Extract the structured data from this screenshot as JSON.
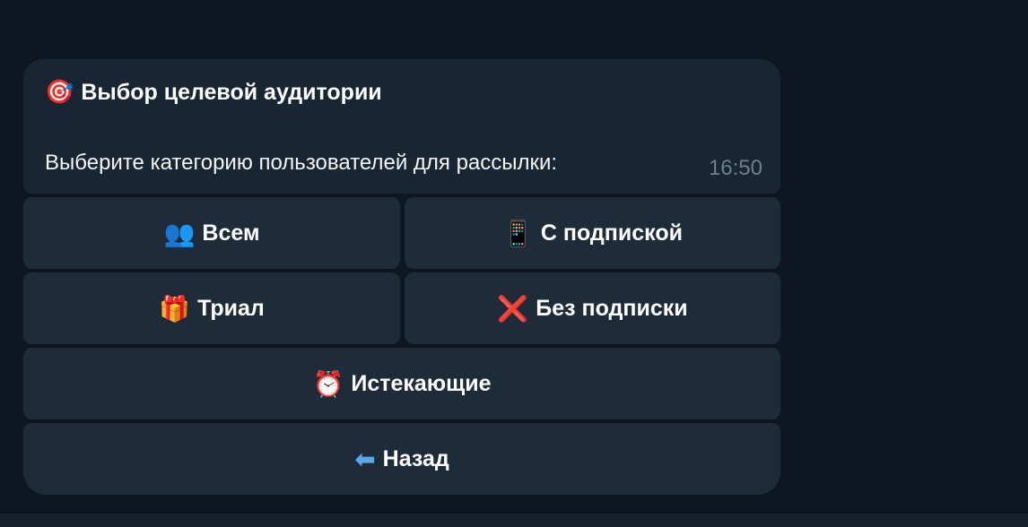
{
  "message": {
    "title": "Выбор целевой аудитории",
    "title_icon": "🎯",
    "text": "Выберите категорию пользователей для рассылки:",
    "time": "16:50"
  },
  "keyboard": {
    "all": {
      "icon": "👥",
      "label": "Всем"
    },
    "subscribed": {
      "icon": "📱",
      "label": "С подпиской"
    },
    "trial": {
      "icon": "🎁",
      "label": "Триал"
    },
    "unsubscribed": {
      "icon": "❌",
      "label": "Без подписки"
    },
    "expiring": {
      "icon": "⏰",
      "label": "Истекающие"
    },
    "back": {
      "icon": "⬅",
      "label": "Назад"
    }
  },
  "colors": {
    "background": "#0e1621",
    "bubble": "#182533",
    "button": "#1e2c3a",
    "time_text": "#6d7f8f"
  }
}
